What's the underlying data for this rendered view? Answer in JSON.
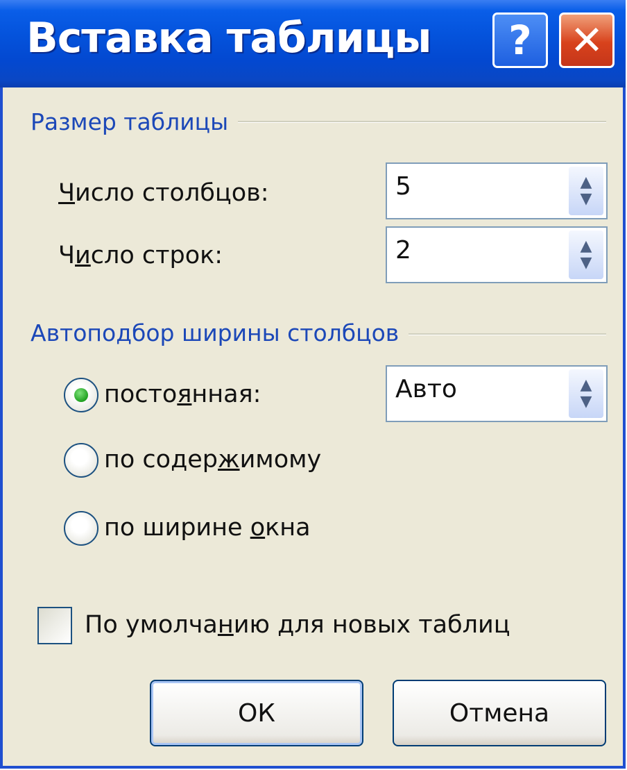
{
  "window": {
    "title": "Вставка таблицы",
    "help_glyph": "?",
    "close_glyph": "✕"
  },
  "size_group": {
    "label": "Размер таблицы",
    "columns": {
      "label_pre": "",
      "label_acc": "Ч",
      "label_post": "исло столбцов:",
      "value": "5"
    },
    "rows": {
      "label_pre": "Ч",
      "label_acc": "и",
      "label_post": "сло строк:",
      "value": "2"
    }
  },
  "autofit_group": {
    "label": "Автоподбор ширины столбцов",
    "fixed": {
      "label_pre": "посто",
      "label_acc": "я",
      "label_post": "нная:",
      "value": "Авто",
      "selected": true
    },
    "content": {
      "label_pre": "по содер",
      "label_acc": "ж",
      "label_post": "имому",
      "selected": false
    },
    "window": {
      "label_pre": "по ширине ",
      "label_acc": "о",
      "label_post": "кна",
      "selected": false
    }
  },
  "default_checkbox": {
    "label_pre": "По умолча",
    "label_acc": "н",
    "label_post": "ию для новых таблиц",
    "checked": false
  },
  "buttons": {
    "ok": "ОК",
    "cancel": "Отмена"
  },
  "colors": {
    "title_bar": "#0453dc",
    "group_label": "#1c48b8",
    "face": "#ece9d8",
    "close": "#d8421c"
  }
}
